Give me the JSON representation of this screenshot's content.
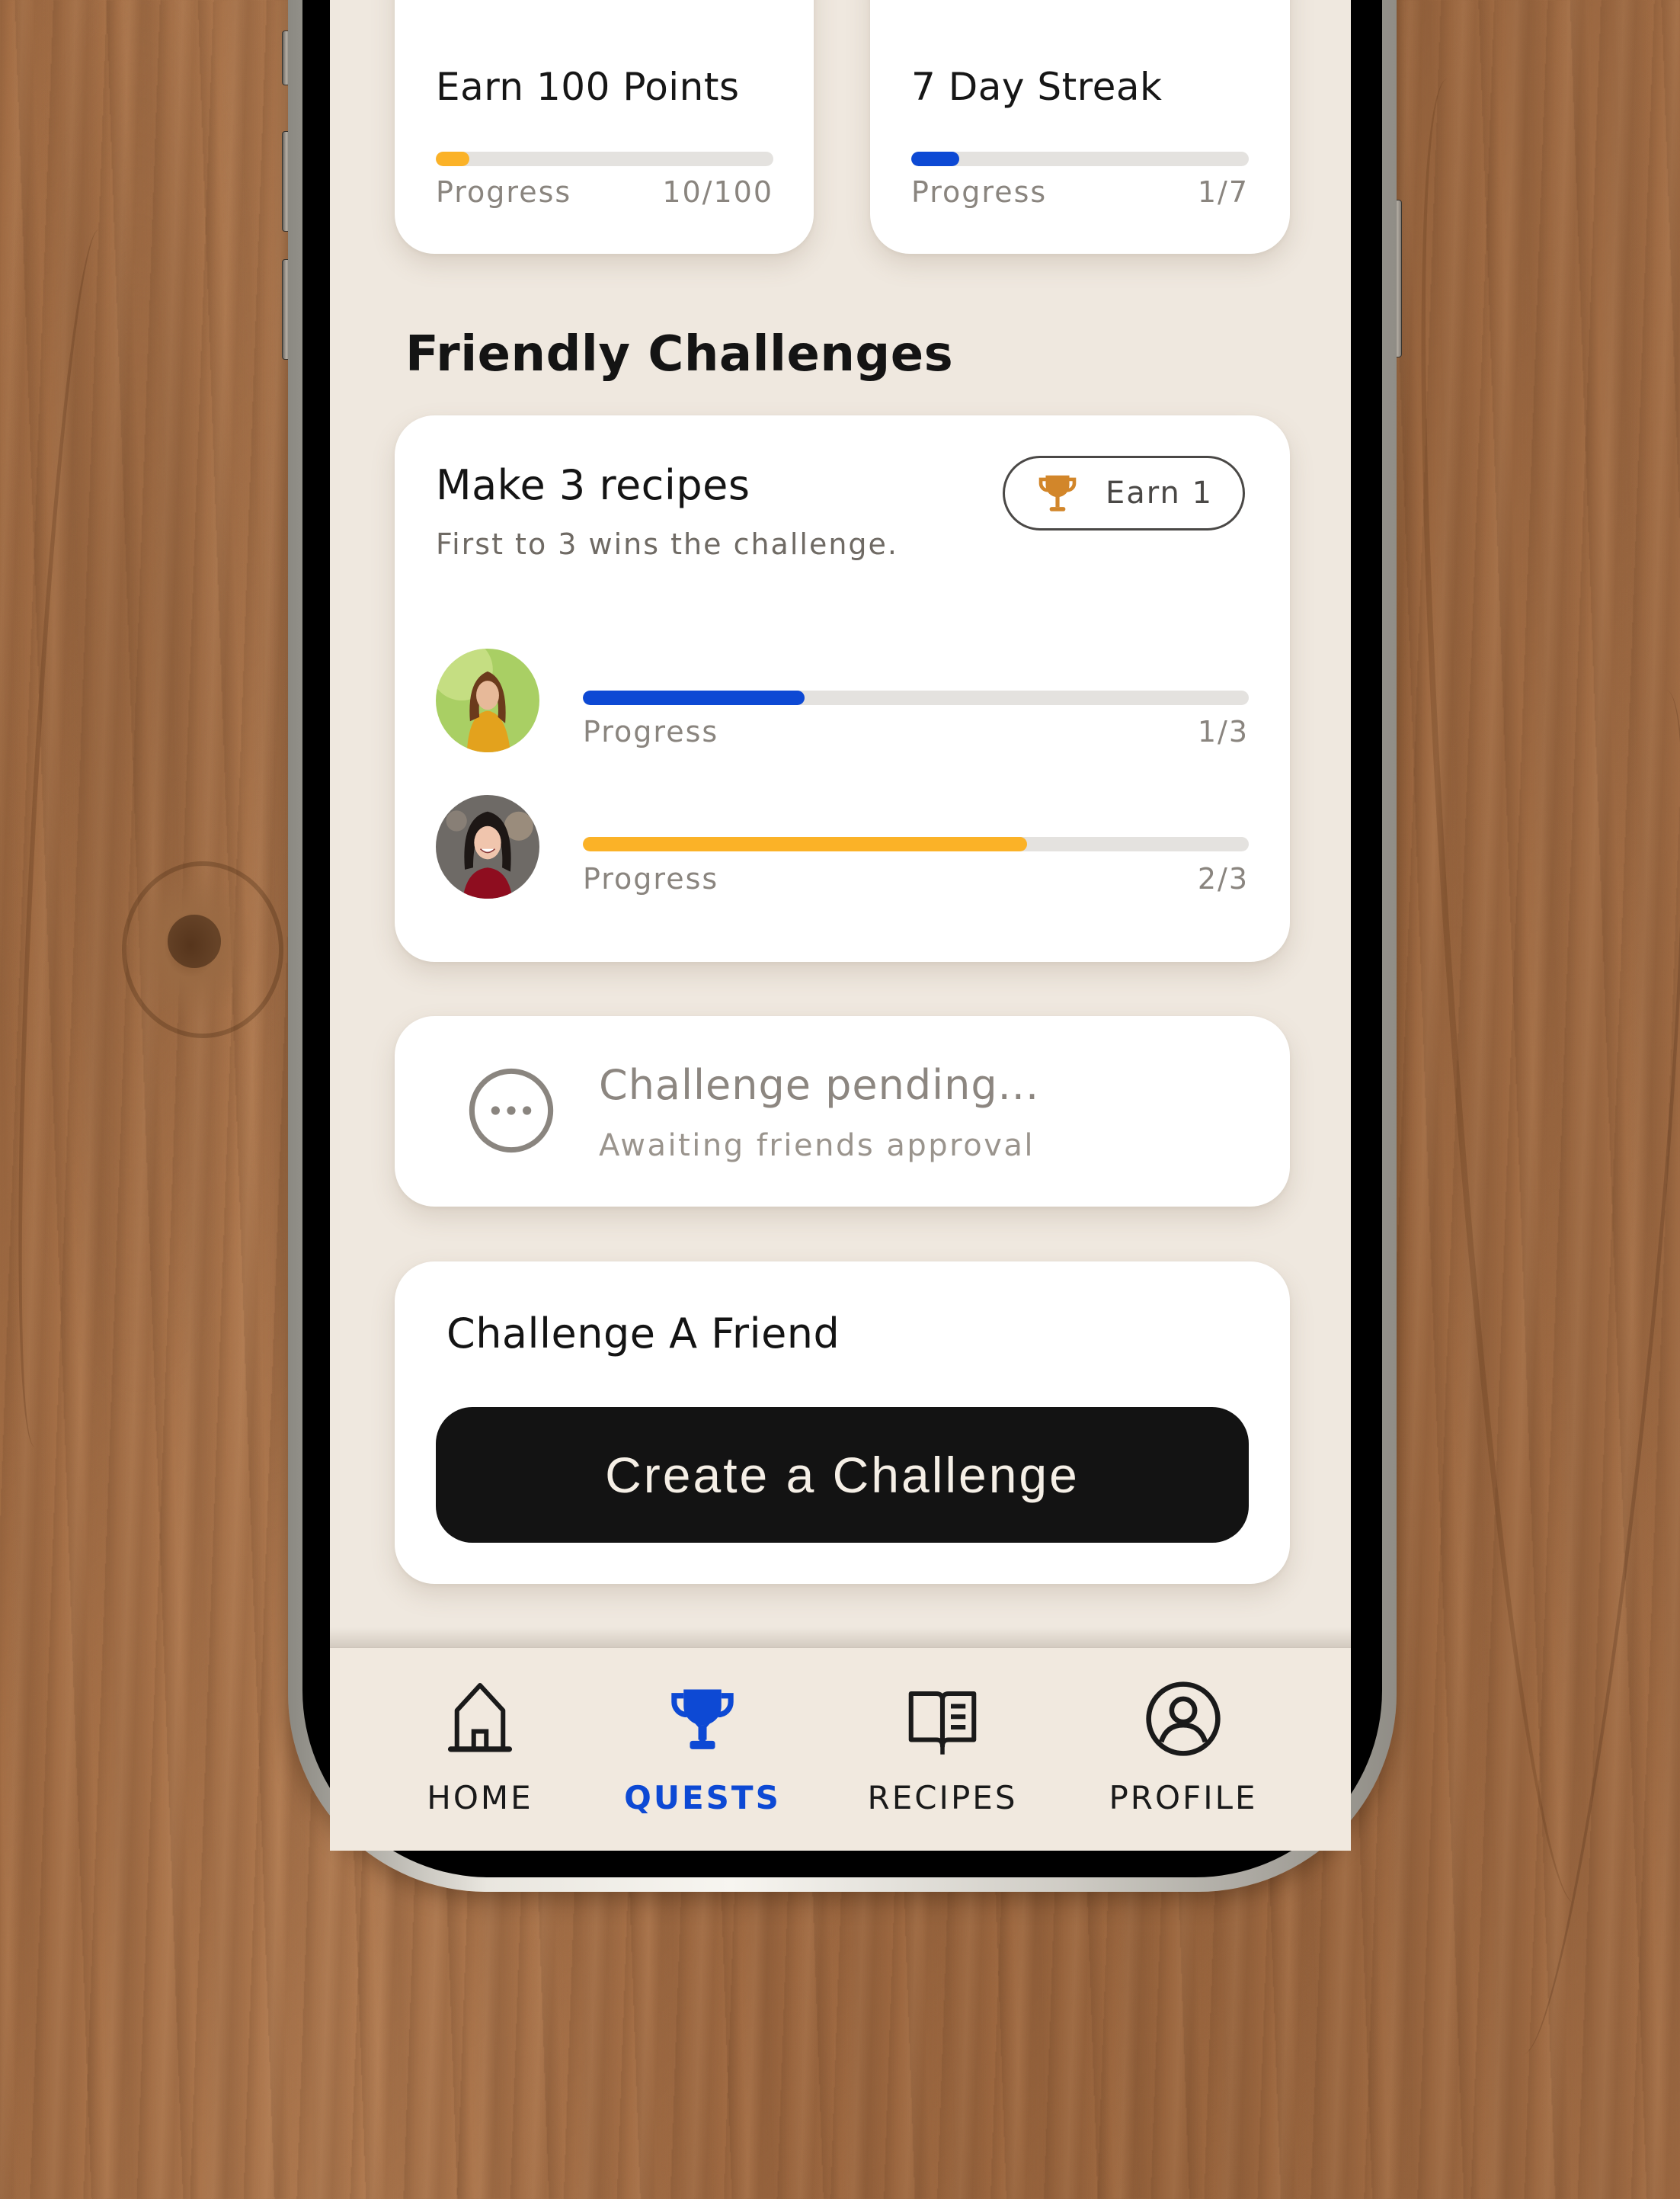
{
  "colors": {
    "accent_blue": "#0d49d4",
    "accent_yellow": "#fbb227",
    "trophy_bronze": "#d2862a",
    "screen_bg": "#efe8df",
    "card_bg": "#ffffff",
    "button_bg": "#131313"
  },
  "quests": [
    {
      "title": "Earn 100 Points",
      "progress_label": "Progress",
      "progress_text": "10/100",
      "current": 10,
      "total": 100,
      "bar_color": "#fbb227"
    },
    {
      "title": "7 Day Streak",
      "progress_label": "Progress",
      "progress_text": "1/7",
      "current": 1,
      "total": 7,
      "bar_color": "#0d49d4"
    }
  ],
  "friendly_challenges": {
    "heading": "Friendly Challenges",
    "active_challenge": {
      "title": "Make 3 recipes",
      "description": "First to 3 wins the challenge.",
      "reward_badge": {
        "icon": "trophy-icon",
        "label": "Earn 1"
      },
      "participants": [
        {
          "avatar": "avatar-woman-yellow-sweater",
          "progress_label": "Progress",
          "progress_text": "1/3",
          "current": 1,
          "total": 3,
          "bar_color": "#0d49d4"
        },
        {
          "avatar": "avatar-woman-red-top",
          "progress_label": "Progress",
          "progress_text": "2/3",
          "current": 2,
          "total": 3,
          "bar_color": "#fbb227"
        }
      ]
    },
    "pending": {
      "icon": "more-dots-icon",
      "title": "Challenge pending...",
      "subtitle": "Awaiting friends approval"
    },
    "challenge_friend": {
      "title": "Challenge A Friend",
      "button_label": "Create a Challenge"
    }
  },
  "bottom_nav": {
    "items": [
      {
        "label": "HOME",
        "icon": "home-icon",
        "active": false
      },
      {
        "label": "QUESTS",
        "icon": "trophy-icon",
        "active": true
      },
      {
        "label": "RECIPES",
        "icon": "book-icon",
        "active": false
      },
      {
        "label": "PROFILE",
        "icon": "profile-icon",
        "active": false
      }
    ]
  }
}
